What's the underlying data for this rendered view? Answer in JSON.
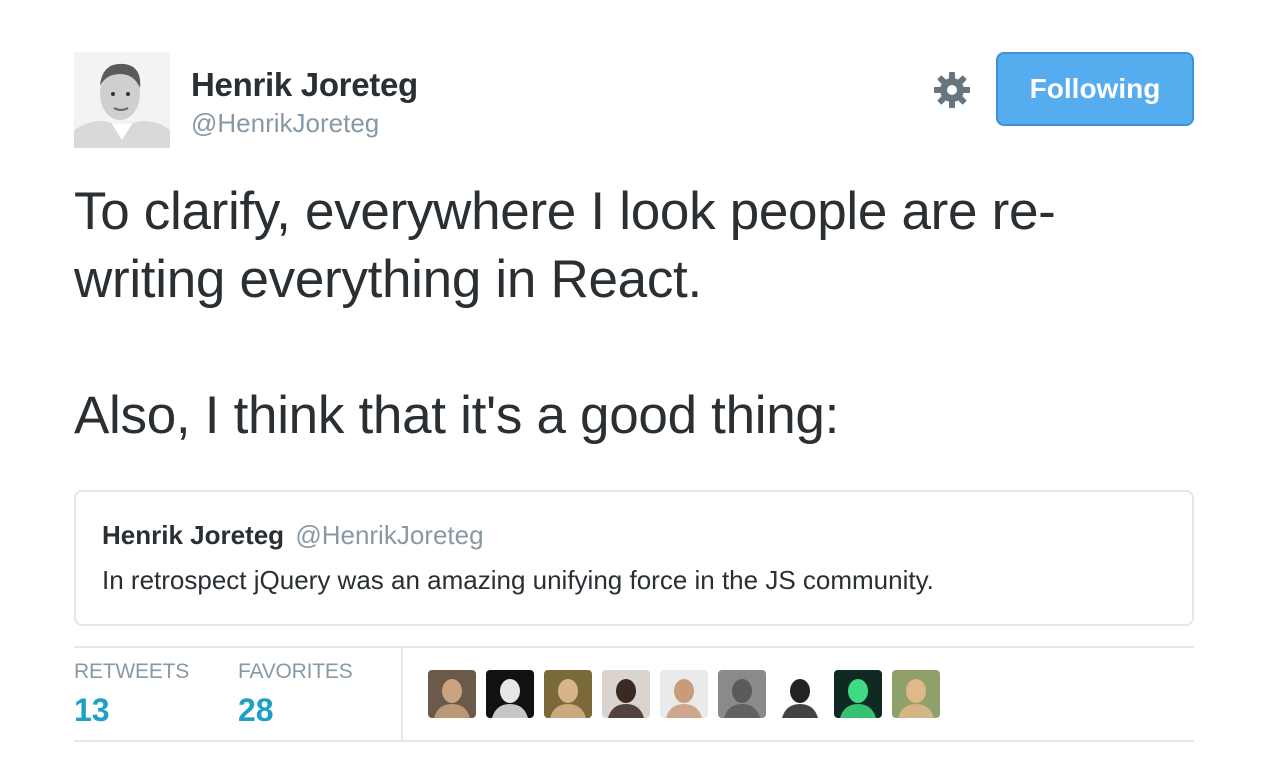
{
  "author": {
    "name": "Henrik Joreteg",
    "handle": "@HenrikJoreteg"
  },
  "follow_button": {
    "label": "Following",
    "color": "#55acee"
  },
  "tweet": {
    "paragraph_1": "To clarify, everywhere I look people are re-writing everything in React.",
    "paragraph_2": "Also, I think that it's a good thing:"
  },
  "quoted_tweet": {
    "name": "Henrik Joreteg",
    "handle": "@HenrikJoreteg",
    "text": "In retrospect jQuery was an amazing unifying force in the JS community."
  },
  "stats": {
    "retweets_label": "RETWEETS",
    "retweets_value": "13",
    "favorites_label": "FAVORITES",
    "favorites_value": "28"
  },
  "favoriters": [
    {
      "name": "favoriter-avatar-1",
      "bg": "#6b5a4a",
      "fg": "#c9a27e"
    },
    {
      "name": "favoriter-avatar-2",
      "bg": "#111111",
      "fg": "#e6e6e6"
    },
    {
      "name": "favoriter-avatar-3",
      "bg": "#7a6a3a",
      "fg": "#d8b48a"
    },
    {
      "name": "favoriter-avatar-4",
      "bg": "#d9d4cf",
      "fg": "#3a2a22"
    },
    {
      "name": "favoriter-avatar-5",
      "bg": "#eaeaea",
      "fg": "#c89b7b"
    },
    {
      "name": "favoriter-avatar-6",
      "bg": "#8a8a8a",
      "fg": "#5a5a5a"
    },
    {
      "name": "favoriter-avatar-7",
      "bg": "#ffffff",
      "fg": "#222222"
    },
    {
      "name": "favoriter-avatar-8",
      "bg": "#0f2a22",
      "fg": "#3ddc84"
    },
    {
      "name": "favoriter-avatar-9",
      "bg": "#8fa06a",
      "fg": "#e0b88a"
    }
  ]
}
